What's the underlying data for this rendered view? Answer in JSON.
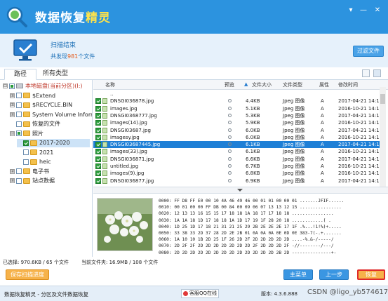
{
  "app": {
    "title_main": "数据恢复",
    "title_accent": "精灵"
  },
  "window_controls": {
    "settings": "▾",
    "minimize": "—",
    "close": "✕"
  },
  "scan": {
    "status": "扫描结束",
    "found_prefix": "共发现",
    "found_count": "981",
    "found_suffix": "个文件"
  },
  "filter_label": "过滤文件",
  "tabs": [
    "路径",
    "所有类型"
  ],
  "tree": [
    {
      "label": "本地磁盘(当前分区)(I:)",
      "level": 0,
      "expander": "⊟",
      "check": "part",
      "icon": "drive",
      "bold": true
    },
    {
      "label": "$Extend",
      "level": 1,
      "expander": "⊞",
      "check": "",
      "icon": "folder"
    },
    {
      "label": "$RECYCLE.BIN",
      "level": 1,
      "expander": "⊞",
      "check": "",
      "icon": "folder"
    },
    {
      "label": "System Volume Inform",
      "level": 1,
      "expander": "⊞",
      "check": "",
      "icon": "folder"
    },
    {
      "label": "恢复的文件",
      "level": 1,
      "expander": "",
      "check": "",
      "icon": "folder"
    },
    {
      "label": "照片",
      "level": 1,
      "expander": "⊟",
      "check": "part",
      "icon": "folder"
    },
    {
      "label": "2017-2020",
      "level": 2,
      "expander": "",
      "check": "on",
      "icon": "folder",
      "selected": true
    },
    {
      "label": "2021",
      "level": 2,
      "expander": "",
      "check": "",
      "icon": "folder"
    },
    {
      "label": "heic",
      "level": 2,
      "expander": "",
      "check": "",
      "icon": "folder"
    },
    {
      "label": "电子书",
      "level": 1,
      "expander": "⊞",
      "check": "",
      "icon": "folder"
    },
    {
      "label": "站点数据",
      "level": 1,
      "expander": "⊞",
      "check": "",
      "icon": "folder"
    }
  ],
  "columns": {
    "name": "名称",
    "preview": "预览",
    "size": "文件大小",
    "type": "文件类型",
    "attr": "属性",
    "modified": "修改时间"
  },
  "files": [
    {
      "name": "..",
      "check": "",
      "preview": "",
      "size": "",
      "type": "",
      "attr": "",
      "modified": ""
    },
    {
      "name": "DNSGI036878.jpg",
      "check": "on",
      "preview": "lens",
      "size": "4.4KB",
      "type": "Jpeg 图像",
      "attr": "A",
      "modified": "2017-04-21 14:1"
    },
    {
      "name": "images.jpg",
      "check": "on",
      "preview": "lens",
      "size": "5.1KB",
      "type": "Jpeg 图像",
      "attr": "A",
      "modified": "2016-10-21 14:1"
    },
    {
      "name": "DNSGI0368777.jpg",
      "check": "on",
      "preview": "lens",
      "size": "5.3KB",
      "type": "Jpeg 图像",
      "attr": "A",
      "modified": "2017-04-21 14:1"
    },
    {
      "name": "images(14).jpg",
      "check": "on",
      "preview": "lens",
      "size": "5.9KB",
      "type": "Jpeg 图像",
      "attr": "A",
      "modified": "2016-10-21 14:1"
    },
    {
      "name": "DNSGI03687.jpg",
      "check": "on",
      "preview": "lens",
      "size": "6.0KB",
      "type": "Jpeg 图像",
      "attr": "A",
      "modified": "2017-04-21 14:1"
    },
    {
      "name": "imagesy.jpg",
      "check": "on",
      "preview": "lens",
      "size": "6.0KB",
      "type": "Jpeg 图像",
      "attr": "A",
      "modified": "2016-10-21 14:1"
    },
    {
      "name": "DNSGI03687445.jpg",
      "check": "on",
      "preview": "lens",
      "size": "6.1KB",
      "type": "Jpeg 图像",
      "attr": "A",
      "modified": "2017-04-21 14:1",
      "selected": true
    },
    {
      "name": "images(33).jpg",
      "check": "on",
      "preview": "lens",
      "size": "6.1KB",
      "type": "Jpeg 图像",
      "attr": "A",
      "modified": "2016-10-21 14:1"
    },
    {
      "name": "DNSGI036871.jpg",
      "check": "on",
      "preview": "lens",
      "size": "6.6KB",
      "type": "Jpeg 图像",
      "attr": "A",
      "modified": "2017-04-21 14:1"
    },
    {
      "name": "untitled.jpg",
      "check": "on",
      "preview": "lens",
      "size": "6.7KB",
      "type": "Jpeg 图像",
      "attr": "A",
      "modified": "2016-10-21 14:1"
    },
    {
      "name": "images(9).jpg",
      "check": "on",
      "preview": "lens",
      "size": "6.8KB",
      "type": "Jpeg 图像",
      "attr": "A",
      "modified": "2016-10-21 14:1"
    },
    {
      "name": "DNSGI036877.jpg",
      "check": "on",
      "preview": "lens",
      "size": "6.9KB",
      "type": "Jpeg 图像",
      "attr": "A",
      "modified": "2017-04-21 14:1"
    }
  ],
  "hex": [
    "0000: FF D8 FF E0 00 10 4A 46 49 46 00 01 01 00 00 01 .......JFIF......",
    "0010: 00 01 00 00 FF DB 00 84 00 09 06 07 13 13 12 15 ................",
    "0020: 12 13 13 16 15 15 17 18 18 1A 18 17 17 18 18 ................",
    "0030: 1A 1A 18 1D 17 18 18 1A 1D 17 19 1F 28 20 18 ............( .",
    "0040: 1D 25 1D 17 18 21 31 21 25 29 2B 2E 2E 2E 17 1F .%...!1!%)+.....",
    "0050: 33 38 33 2D 37 28 2D 2E 2B 01 0A 0A 0A 0E 0D 0E 383-7(-.+.......",
    "0060: 1A 10 10 1B 2D 25 1F 26 2D 2F 2D 2D 2D 2D 2D ....-%.&-/-----/",
    "0070: 2D 2F 2F 2D 2D 2D 2D 2D 2D 2D 2F 2D 2D 2D 2F -//--------/---/",
    "0080: 2D 2D 2D 2D 2D 2D 2D 2D 2D 2D 2D 2D 2D 2B 2D ---------------+-",
    "0090: 2D 2D 2D 2D 2D 2D 2D 2D 2D 2D 2D 2D 2D 2D 2D ----------------"
  ],
  "selection_info": "已选择: 970.6KB / 65 个文件",
  "current_folder": "当前文件夹: 16.9MB / 108 个文件",
  "buttons": {
    "save": "保存扫描进度",
    "main_menu": "主菜单",
    "prev": "上一步",
    "recover": "恢复"
  },
  "footer": {
    "left": "数据恢复精灵 - 分区及文件数据恢复",
    "qq": "客服QQ在线",
    "version": "版本: 4.3.6.888",
    "watermark": "CSDN @ligo_yb574617"
  },
  "colors": {
    "titlebar": "#2c93df",
    "accent_title": "#ffe34a",
    "selection": "#1e7fd6",
    "recover_border": "#e02a2a",
    "checkbox_on": "#2a9c3c"
  }
}
